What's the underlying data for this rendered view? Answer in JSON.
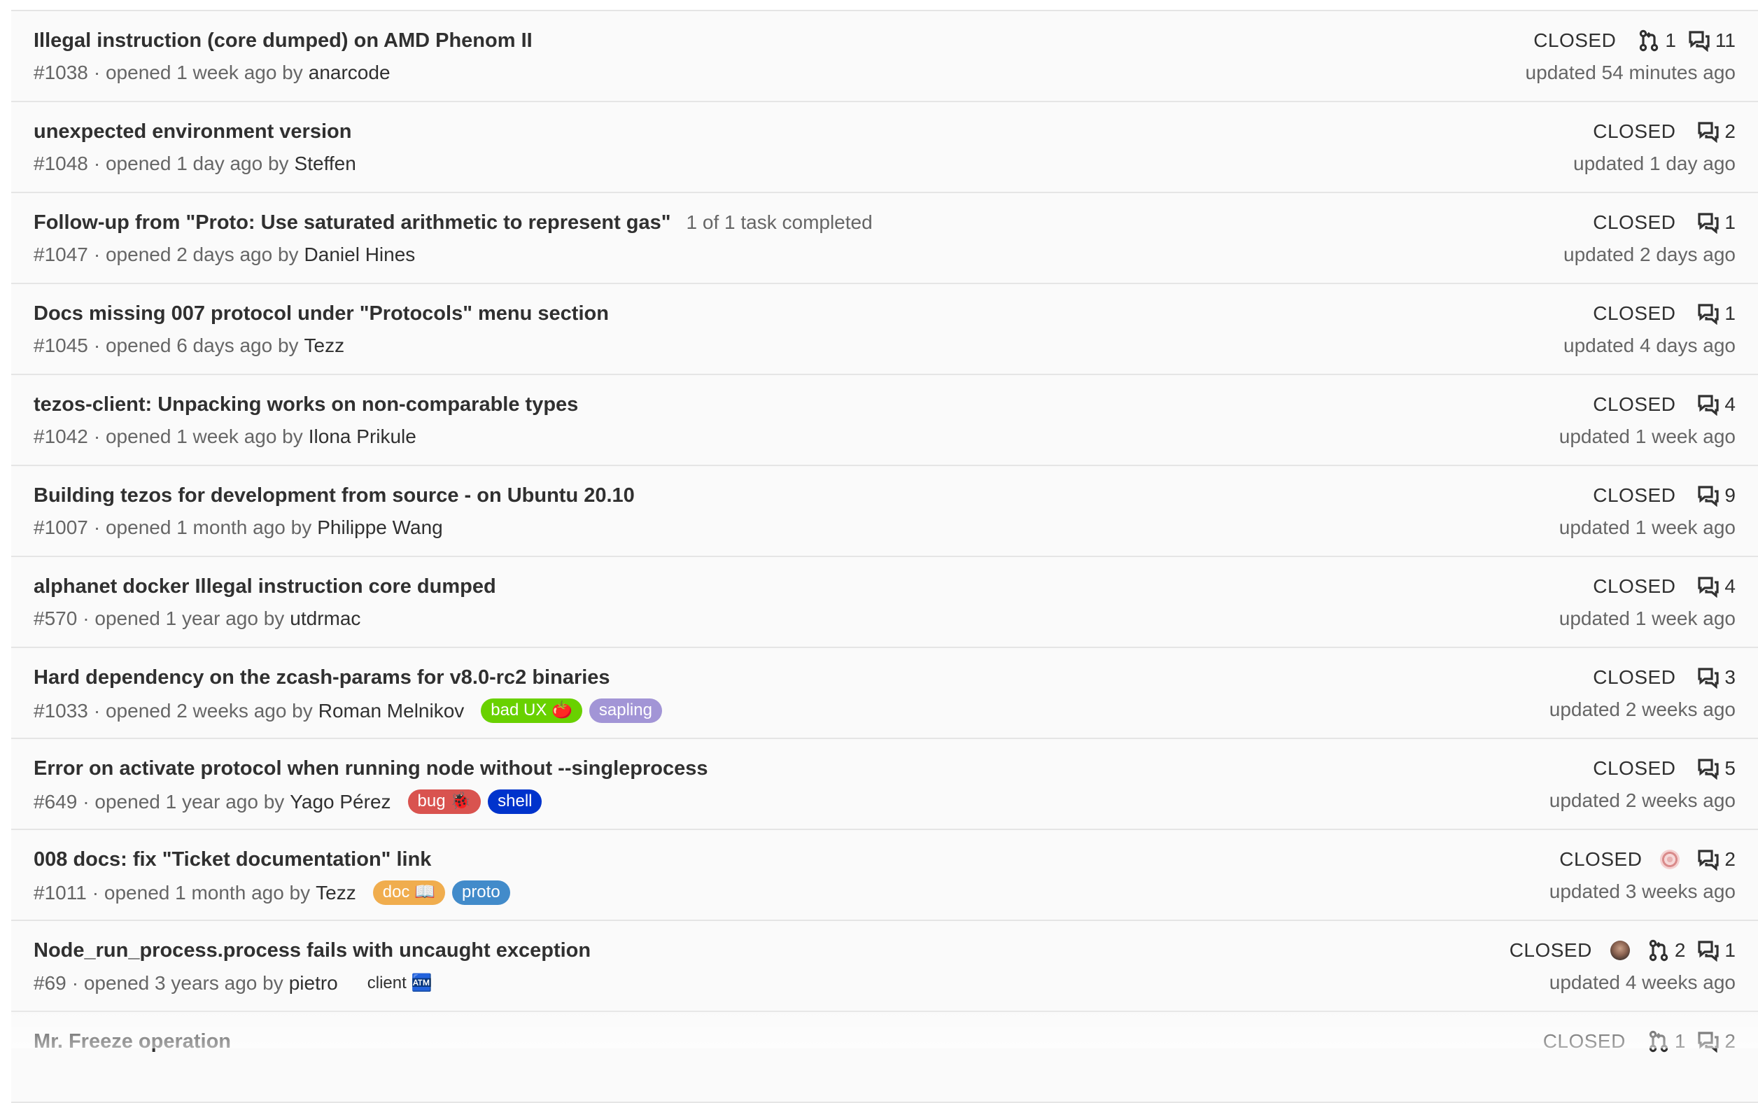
{
  "issues": [
    {
      "title": "Illegal instruction (core dumped) on AMD Phenom II",
      "tasks": "",
      "ref": "#1038",
      "opened": "· opened 1 week ago by",
      "author": "anarcode",
      "labels": [],
      "status": "CLOSED",
      "avatar": "",
      "mrs": "1",
      "comments": "11",
      "updated": "updated 54 minutes ago"
    },
    {
      "title": "unexpected environment version",
      "tasks": "",
      "ref": "#1048",
      "opened": "· opened 1 day ago by",
      "author": "Steffen",
      "labels": [],
      "status": "CLOSED",
      "avatar": "",
      "mrs": "",
      "comments": "2",
      "updated": "updated 1 day ago"
    },
    {
      "title": "Follow-up from \"Proto: Use saturated arithmetic to represent gas\"",
      "tasks": "1 of 1 task completed",
      "ref": "#1047",
      "opened": "· opened 2 days ago by",
      "author": "Daniel Hines",
      "labels": [],
      "status": "CLOSED",
      "avatar": "",
      "mrs": "",
      "comments": "1",
      "updated": "updated 2 days ago"
    },
    {
      "title": "Docs missing 007 protocol under \"Protocols\" menu section",
      "tasks": "",
      "ref": "#1045",
      "opened": "· opened 6 days ago by",
      "author": "Tezz",
      "labels": [],
      "status": "CLOSED",
      "avatar": "",
      "mrs": "",
      "comments": "1",
      "updated": "updated 4 days ago"
    },
    {
      "title": "tezos-client: Unpacking works on non-comparable types",
      "tasks": "",
      "ref": "#1042",
      "opened": "· opened 1 week ago by",
      "author": "Ilona Prikule",
      "labels": [],
      "status": "CLOSED",
      "avatar": "",
      "mrs": "",
      "comments": "4",
      "updated": "updated 1 week ago"
    },
    {
      "title": "Building tezos for development from source - on Ubuntu 20.10",
      "tasks": "",
      "ref": "#1007",
      "opened": "· opened 1 month ago by",
      "author": "Philippe Wang",
      "labels": [],
      "status": "CLOSED",
      "avatar": "",
      "mrs": "",
      "comments": "9",
      "updated": "updated 1 week ago"
    },
    {
      "title": "alphanet docker Illegal instruction core dumped",
      "tasks": "",
      "ref": "#570",
      "opened": "· opened 1 year ago by",
      "author": "utdrmac",
      "labels": [],
      "status": "CLOSED",
      "avatar": "",
      "mrs": "",
      "comments": "4",
      "updated": "updated 1 week ago"
    },
    {
      "title": "Hard dependency on the zcash-params for v8.0-rc2 binaries",
      "tasks": "",
      "ref": "#1033",
      "opened": "· opened 2 weeks ago by",
      "author": "Roman Melnikov",
      "labels": [
        {
          "text": "bad UX 🍅",
          "color": "#69d100",
          "kind": "filled"
        },
        {
          "text": "sapling",
          "color": "#a295d6",
          "kind": "filled"
        }
      ],
      "status": "CLOSED",
      "avatar": "",
      "mrs": "",
      "comments": "3",
      "updated": "updated 2 weeks ago"
    },
    {
      "title": "Error on activate protocol when running node without --singleprocess",
      "tasks": "",
      "ref": "#649",
      "opened": "· opened 1 year ago by",
      "author": "Yago Pérez",
      "labels": [
        {
          "text": "bug 🐞",
          "color": "#d9534f",
          "kind": "filled"
        },
        {
          "text": "shell",
          "color": "#0033cc",
          "kind": "filled"
        }
      ],
      "status": "CLOSED",
      "avatar": "",
      "mrs": "",
      "comments": "5",
      "updated": "updated 2 weeks ago"
    },
    {
      "title": "008 docs: fix \"Ticket documentation\" link",
      "tasks": "",
      "ref": "#1011",
      "opened": "· opened 1 month ago by",
      "author": "Tezz",
      "labels": [
        {
          "text": "doc 📖",
          "color": "#f0ad4e",
          "kind": "filled"
        },
        {
          "text": "proto",
          "color": "#428bca",
          "kind": "filled"
        }
      ],
      "status": "CLOSED",
      "avatar": "pattern",
      "mrs": "",
      "comments": "2",
      "updated": "updated 3 weeks ago"
    },
    {
      "title": "Node_run_process.process fails with uncaught exception",
      "tasks": "",
      "ref": "#69",
      "opened": "· opened 3 years ago by",
      "author": "pietro",
      "labels": [
        {
          "text": "client 🏧",
          "color": "#ffffff",
          "kind": "plain"
        }
      ],
      "status": "CLOSED",
      "avatar": "photo",
      "mrs": "2",
      "comments": "1",
      "updated": "updated 4 weeks ago"
    },
    {
      "title": "Mr. Freeze operation",
      "tasks": "",
      "ref": "",
      "opened": "",
      "author": "",
      "labels": [],
      "status": "CLOSED",
      "avatar": "",
      "mrs": "1",
      "comments": "2",
      "updated": ""
    }
  ],
  "colors": {
    "row_bg": "#fafafa",
    "border": "#e5e5e5",
    "muted": "#666666",
    "text": "#303030"
  },
  "icons": {
    "merge_requests": "merge-request-icon",
    "comments": "comments-icon"
  }
}
